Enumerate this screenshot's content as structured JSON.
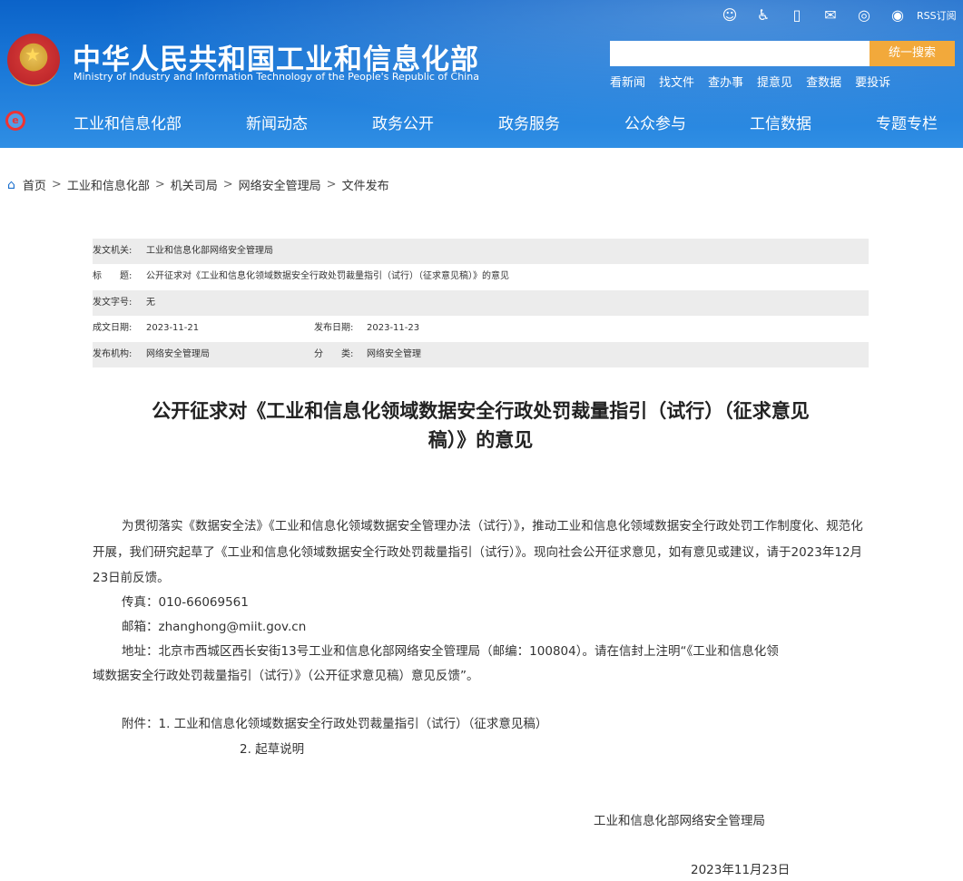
{
  "header": {
    "site_title": "中华人民共和国工业和信息化部",
    "site_subtitle": "Ministry of Industry and Information Technology of the People's Republic of China",
    "rss_label": "RSS订阅",
    "search_placeholder": "",
    "search_button": "统一搜索",
    "quick_links": [
      "看新闻",
      "找文件",
      "查办事",
      "提意见",
      "查数据",
      "要投诉"
    ],
    "nav": [
      "工业和信息化部",
      "新闻动态",
      "政务公开",
      "政务服务",
      "公众参与",
      "工信数据",
      "专题专栏"
    ]
  },
  "breadcrumb": [
    "首页",
    "工业和信息化部",
    "机关司局",
    "网络安全管理局",
    "文件发布"
  ],
  "meta": {
    "issuer_label": "发文机关:",
    "issuer": "工业和信息化部网络安全管理局",
    "title_label": "标　　题:",
    "title": "公开征求对《工业和信息化领域数据安全行政处罚裁量指引（试行）（征求意见稿）》的意见",
    "docno_label": "发文字号:",
    "docno": "无",
    "written_label": "成文日期:",
    "written": "2023-11-21",
    "published_label": "发布日期:",
    "published": "2023-11-23",
    "agency_label": "发布机构:",
    "agency": "网络安全管理局",
    "category_label": "分　　类:",
    "category": "网络安全管理"
  },
  "article": {
    "title_line1": "公开征求对《工业和信息化领域数据安全行政处罚裁量指引（试行）（征求意见",
    "title_line2": "稿）》的意见",
    "para1": "为贯彻落实《数据安全法》《工业和信息化领域数据安全管理办法（试行）》，推动工业和信息化领域数据安全行政处罚工作制度化、规范化开展，我们研究起草了《工业和信息化领域数据安全行政处罚裁量指引（试行）》。现向社会公开征求意见，如有意见或建议，请于2023年12月23日前反馈。",
    "fax": "传真：010-66069561",
    "email": "邮箱：zhanghong@miit.gov.cn",
    "address_line1": "地址：北京市西城区西长安街13号工业和信息化部网络安全管理局（邮编：100804）。请在信封上注明“《工业和信息化领",
    "address_line2": "域数据安全行政处罚裁量指引（试行）》（公开征求意见稿）意见反馈”。",
    "attachment1": "附件：1. 工业和信息化领域数据安全行政处罚裁量指引（试行）（征求意见稿）",
    "attachment2": "2. 起草说明",
    "signature": "工业和信息化部网络安全管理局",
    "date": "2023年11月23日"
  }
}
